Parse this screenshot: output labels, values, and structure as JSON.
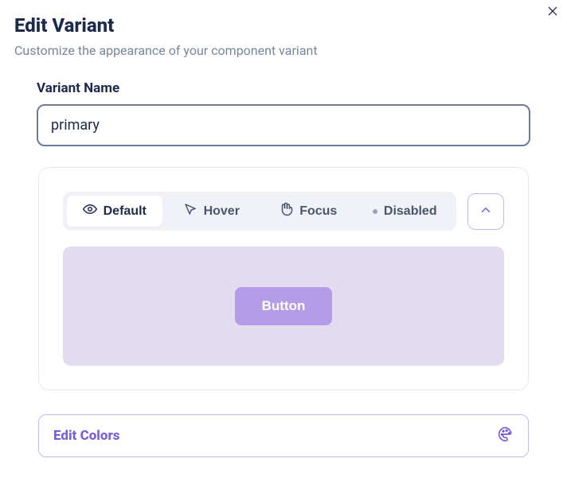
{
  "modal": {
    "title": "Edit Variant",
    "subtitle": "Customize the appearance of your component variant"
  },
  "variantName": {
    "label": "Variant Name",
    "value": "primary"
  },
  "stateTabs": {
    "items": [
      {
        "label": "Default",
        "active": true
      },
      {
        "label": "Hover",
        "active": false
      },
      {
        "label": "Focus",
        "active": false
      },
      {
        "label": "Disabled",
        "active": false
      }
    ]
  },
  "preview": {
    "sampleButtonLabel": "Button"
  },
  "editColors": {
    "label": "Edit Colors"
  },
  "colors": {
    "accent": "#7a5fd6",
    "buttonBg": "#b49ce8",
    "stageBg": "#e1dcf0"
  }
}
